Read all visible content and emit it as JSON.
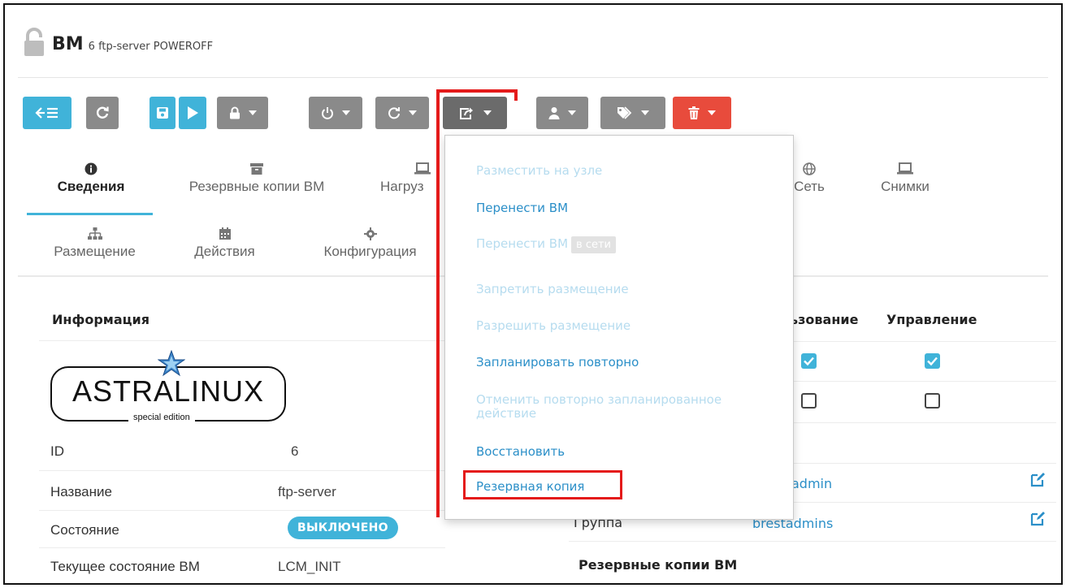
{
  "header": {
    "title": "ВМ",
    "subtitle": "6 ftp-server POWEROFF"
  },
  "toolbar": {
    "buttons": [
      {
        "name": "back-to-list",
        "icon": "back-list-icon",
        "color": "#40b3d9"
      },
      {
        "name": "refresh",
        "icon": "refresh-icon",
        "color": "#8a8a8a"
      },
      {
        "name": "save",
        "icon": "save-icon",
        "color": "#40b3d9"
      },
      {
        "name": "play",
        "icon": "play-icon",
        "color": "#40b3d9"
      },
      {
        "name": "lock-menu",
        "icon": "lock-icon",
        "color": "#8a8a8a"
      },
      {
        "name": "power-menu",
        "icon": "power-icon",
        "color": "#8a8a8a"
      },
      {
        "name": "reboot-menu",
        "icon": "reboot-icon",
        "color": "#8a8a8a"
      },
      {
        "name": "migrate-menu",
        "icon": "share-icon",
        "color": "#6b6b6b"
      },
      {
        "name": "user-menu",
        "icon": "user-icon",
        "color": "#8a8a8a"
      },
      {
        "name": "tag-menu",
        "icon": "tag-icon",
        "color": "#8a8a8a"
      },
      {
        "name": "delete-menu",
        "icon": "trash-icon",
        "color": "#e84b3c"
      }
    ]
  },
  "tabs": {
    "row1": [
      "Сведения",
      "Резервные копии ВМ",
      "Нагруз",
      "Сеть",
      "Снимки"
    ],
    "row2": [
      "Размещение",
      "Действия",
      "Конфигурация"
    ]
  },
  "info": {
    "title": "Информация",
    "logo_text": "ASTRALINUX",
    "logo_sub": "special edition",
    "rows": [
      {
        "label": "ID",
        "value": "6"
      },
      {
        "label": "Название",
        "value": "ftp-server"
      },
      {
        "label": "Состояние",
        "value": "ВЫКЛЮЧЕНО"
      },
      {
        "label": "Текущее состояние ВМ",
        "value": "LCM_INIT"
      }
    ]
  },
  "permissions": {
    "col_use": "ьзование",
    "col_manage": "Управление",
    "owner_value": "admin",
    "group_label": "Группа",
    "group_value": "brestadmins",
    "backups_title": "Резервные копии ВМ"
  },
  "dropdown": {
    "items": [
      {
        "label": "Разместить на узле",
        "enabled": false
      },
      {
        "label": "Перенести ВМ",
        "enabled": true
      },
      {
        "label": "Перенести ВМ",
        "tag": "в сети",
        "enabled": false
      },
      {
        "label": "Запретить размещение",
        "enabled": false
      },
      {
        "label": "Разрешить размещение",
        "enabled": false
      },
      {
        "label": "Запланировать повторно",
        "enabled": true
      },
      {
        "label": "Отменить повторно запланированное",
        "label2": "действие",
        "enabled": false
      },
      {
        "label": "Восстановить",
        "enabled": true
      },
      {
        "label": "Резервная копия",
        "enabled": true
      }
    ]
  },
  "colors": {
    "accent": "#40b3d9",
    "danger": "#e84b3c",
    "highlight": "#e41a1a",
    "link": "#2b8fc8",
    "disabled_link": "#b6dcef"
  }
}
